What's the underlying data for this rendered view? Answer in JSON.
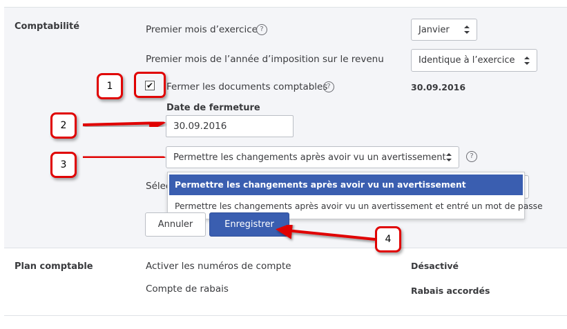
{
  "comptabilite": {
    "title": "Comptabilité",
    "first_month_label": "Premier mois d’exercice",
    "first_month_value": "Janvier",
    "first_tax_month_label": "Premier mois de l’année d’imposition sur le revenu",
    "first_tax_month_value": "Identique à l’exercice",
    "close_books_label": "Fermer les documents comptables",
    "close_books_checked": true,
    "close_books_value": "30.09.2016",
    "closing_date_label": "Date de fermeture",
    "closing_date_value": "30.09.2016",
    "permission_select_value": "Permettre les changements après avoir vu un avertissement",
    "hidden_label_prefix": "Sélec",
    "dropdown_options": [
      "Permettre les changements après avoir vu un avertissement",
      "Permettre les changements après avoir vu un avertissement et entré un mot de passe"
    ],
    "cancel_label": "Annuler",
    "save_label": "Enregistrer"
  },
  "plan_comptable": {
    "title": "Plan comptable",
    "account_numbers_label": "Activer les numéros de compte",
    "account_numbers_value": "Désactivé",
    "discount_account_label": "Compte de rabais",
    "discount_account_value": "Rabais accordés"
  },
  "annotations": [
    "1",
    "2",
    "3",
    "4"
  ],
  "icons": {
    "help": "?",
    "check": "✔"
  },
  "colors": {
    "accent": "#3a5eb0",
    "annotation": "#e00000",
    "section_bg": "#f4f5f8"
  }
}
